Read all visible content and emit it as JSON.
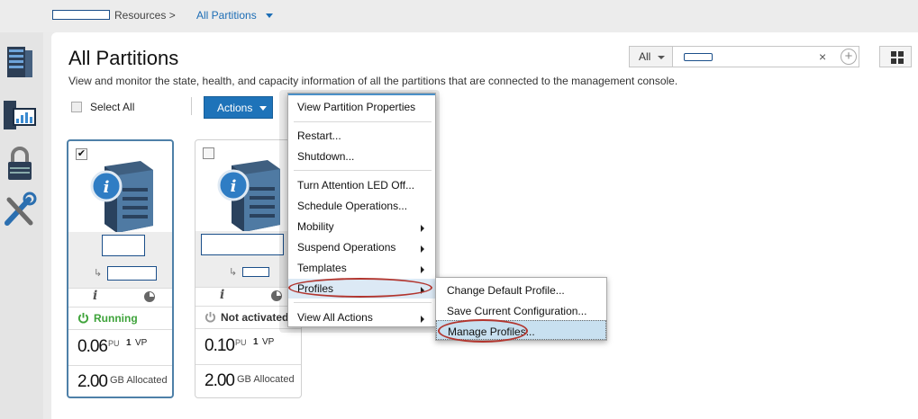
{
  "breadcrumb": {
    "resources_label": "Resources >",
    "current_label": "All Partitions"
  },
  "page": {
    "title": "All Partitions",
    "description": "View and monitor the state, health, and capacity information of all the partitions that are connected to the management console."
  },
  "filter": {
    "scope_value": "All",
    "clear_glyph": "×",
    "add_glyph": "+"
  },
  "toolbar": {
    "select_all_label": "Select All",
    "actions_label": "Actions"
  },
  "cards": [
    {
      "checked": true,
      "check_glyph": "✔",
      "info_glyph": "i",
      "status": "Running",
      "status_color": "#3ea33a",
      "pu_value": "0.06",
      "pu_unit": "PU",
      "vp_value": "1",
      "vp_unit": "VP",
      "mem_value": "2.00",
      "mem_unit": "GB Allocated"
    },
    {
      "checked": false,
      "check_glyph": "",
      "info_glyph": "i",
      "status": "Not activated",
      "status_color": "#333333",
      "pu_value": "0.10",
      "pu_unit": "PU",
      "vp_value": "1",
      "vp_unit": "VP",
      "mem_value": "2.00",
      "mem_unit": "GB Allocated"
    }
  ],
  "actions_menu": {
    "items": [
      {
        "label": "View Partition Properties"
      },
      {
        "label": "Restart..."
      },
      {
        "label": "Shutdown..."
      },
      {
        "label": "Turn Attention LED Off..."
      },
      {
        "label": "Schedule Operations..."
      },
      {
        "label": "Mobility"
      },
      {
        "label": "Suspend Operations"
      },
      {
        "label": "Templates"
      },
      {
        "label": "Profiles"
      },
      {
        "label": "View All Actions"
      }
    ]
  },
  "profiles_submenu": {
    "items": [
      {
        "label": "Change Default Profile..."
      },
      {
        "label": "Save Current Configuration..."
      },
      {
        "label": "Manage Profiles..."
      }
    ]
  },
  "colors": {
    "accent": "#1e73b9",
    "annotation": "#b2352e",
    "selected_card_border": "#4e80a8"
  },
  "icons": {
    "rail": [
      "server-rack-icon",
      "monitoring-icon",
      "lock-icon",
      "tools-icon"
    ],
    "card": "server-info-icon"
  }
}
